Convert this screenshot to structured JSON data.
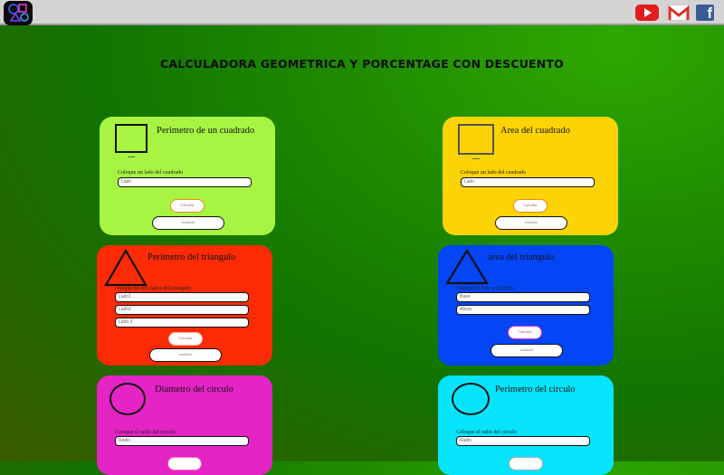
{
  "page": {
    "title": "CALCULADORA GEOMETRICA Y PORCENTAGE CON DESCUENTO"
  },
  "header": {
    "icons": [
      "app-logo-icon",
      "youtube-icon",
      "gmail-icon",
      "facebook-icon"
    ],
    "facebook_glyph": "f"
  },
  "colors": {
    "perimetro_cuadrado": "#a8f442",
    "area_cuadrado": "#fcd405",
    "perimetro_triangulo": "#fb2b06",
    "area_triangulo": "#0445f6",
    "diametro_circulo": "#e424c4",
    "perimetro_circulo": "#06e4fc",
    "calc_button_border": "#f08a1c"
  },
  "cards": {
    "perimetro_cuadrado": {
      "title": "Perimetro de un cuadrado",
      "field_label": "Coloque un lado del cuadrado",
      "placeholders": [
        "Lado"
      ],
      "button": "Calcular",
      "result": "resultado"
    },
    "area_cuadrado": {
      "title": "Area del cuadrado",
      "field_label": "Coloque un lado del cuadrado",
      "placeholders": [
        "Lado"
      ],
      "button": "Calcular",
      "result": "resultado"
    },
    "perimetro_triangulo": {
      "title": "Perimetro del triangulo",
      "field_label": "coloque los tres lados del triangulo",
      "placeholders": [
        "Lado1",
        "Lado2",
        "Lado 3"
      ],
      "button": "Calcular",
      "result": "resultado"
    },
    "area_triangulo": {
      "title": "area del triangulo",
      "field_label": "Coloque la base y la altura",
      "placeholders": [
        "Base",
        "Altura"
      ],
      "button": "Calcular",
      "result": "resultado"
    },
    "diametro_circulo": {
      "title": "Diametro del circulo",
      "field_label": "Coloque el radio del circulo",
      "placeholders": [
        "Radio"
      ]
    },
    "perimetro_circulo": {
      "title": "Perimetro del circulo",
      "field_label": "Coloque el radio del circulo",
      "placeholders": [
        "Radio"
      ]
    }
  }
}
